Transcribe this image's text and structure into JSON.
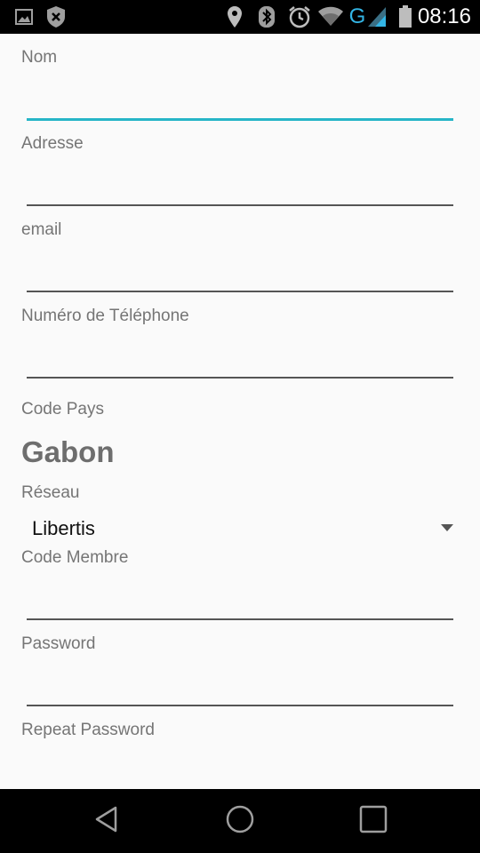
{
  "statusbar": {
    "time": "08:16",
    "network_label": "G",
    "icons": [
      "image-icon",
      "shield-icon",
      "location-icon",
      "bluetooth-icon",
      "alarm-icon",
      "wifi-icon",
      "signal-icon",
      "battery-icon"
    ]
  },
  "form": {
    "nom_label": "Nom",
    "adresse_label": "Adresse",
    "email_label": "email",
    "telephone_label": "Numéro de Téléphone",
    "code_pays_label": "Code Pays",
    "code_pays_value": "Gabon",
    "reseau_label": "Réseau",
    "reseau_value": "Libertis",
    "code_membre_label": "Code Membre",
    "password_label": "Password",
    "repeat_password_label": "Repeat Password"
  },
  "navbar": {
    "icons": [
      "back-icon",
      "home-icon",
      "recents-icon"
    ]
  },
  "colors": {
    "accent": "#26b5c7",
    "label": "#757575",
    "background": "#fafafa"
  }
}
